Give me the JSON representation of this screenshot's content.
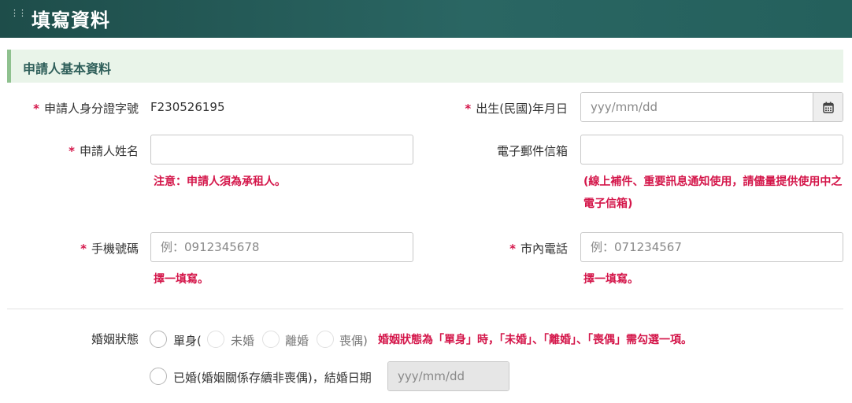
{
  "header": {
    "title": "填寫資料"
  },
  "section": {
    "title": "申請人基本資料"
  },
  "fields": {
    "id_label": "申請人身分證字號",
    "id_value": "F230526195",
    "birth_label": "出生(民國)年月日",
    "birth_placeholder": "yyy/mm/dd",
    "name_label": "申請人姓名",
    "name_value": "",
    "name_note": "注意：申請人須為承租人。",
    "email_label": "電子郵件信箱",
    "email_value": "",
    "email_note": "(線上補件、重要訊息通知使用，請儘量提供使用中之電子信箱)",
    "mobile_label": "手機號碼",
    "mobile_placeholder": "例：0912345678",
    "mobile_note": "擇一填寫。",
    "phone_label": "市內電話",
    "phone_placeholder": "例：071234567",
    "phone_note": "擇一填寫。"
  },
  "marital": {
    "label": "婚姻狀態",
    "single": "單身(",
    "unmarried": "未婚",
    "divorced": "離婚",
    "widowed": "喪偶)",
    "note": "婚姻狀態為「單身」時，「未婚」、「離婚」、「喪偶」需勾選一項。",
    "married": "已婚(婚姻關係存續非喪偶)，結婚日期",
    "date_placeholder": "yyy/mm/dd"
  },
  "required_mark": "*",
  "colors": {
    "header": "#24605c",
    "accent_required": "#d4164a",
    "section_bg": "#e9f4e9",
    "section_border": "#8fc18f"
  }
}
